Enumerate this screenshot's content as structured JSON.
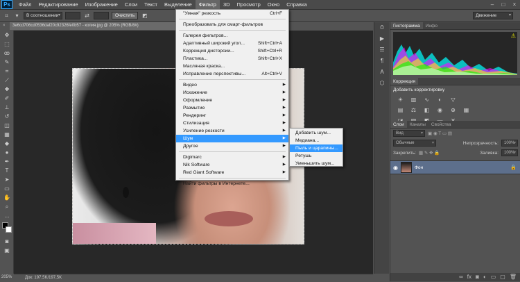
{
  "menubar": {
    "logo": "Ps",
    "items": [
      "Файл",
      "Редактирование",
      "Изображение",
      "Слои",
      "Текст",
      "Выделение",
      "Фильтр",
      "3D",
      "Просмотр",
      "Окно",
      "Справка"
    ],
    "active_index": 6,
    "window_buttons": [
      "–",
      "□",
      "×"
    ]
  },
  "options": {
    "mode_value": "В соотношении",
    "clear_button": "Очистить",
    "workspace_value": "Движение"
  },
  "document": {
    "tab_title": "3e6cd706cd0536daf20c92326fe0b57 - копия.jpg @ 205% (RGB/8#)",
    "status": "Док: 197,5K/197,5K",
    "zoom": "205%"
  },
  "filter_menu": {
    "items": [
      {
        "label": "\"Умная\" резкость",
        "shortcut": "Ctrl+F"
      },
      {
        "sep": true
      },
      {
        "label": "Преобразовать для смарт-фильтров"
      },
      {
        "sep": true
      },
      {
        "label": "Галерея фильтров..."
      },
      {
        "label": "Адаптивный широкий угол...",
        "shortcut": "Shift+Ctrl+A"
      },
      {
        "label": "Коррекция дисторсии...",
        "shortcut": "Shift+Ctrl+R"
      },
      {
        "label": "Пластика...",
        "shortcut": "Shift+Ctrl+X"
      },
      {
        "label": "Масляная краска..."
      },
      {
        "label": "Исправление перспективы...",
        "shortcut": "Alt+Ctrl+V"
      },
      {
        "sep": true
      },
      {
        "label": "Видео",
        "submenu": true
      },
      {
        "label": "Искажение",
        "submenu": true
      },
      {
        "label": "Оформление",
        "submenu": true
      },
      {
        "label": "Размытие",
        "submenu": true
      },
      {
        "label": "Рендеринг",
        "submenu": true
      },
      {
        "label": "Стилизация",
        "submenu": true
      },
      {
        "label": "Усиление резкости",
        "submenu": true
      },
      {
        "label": "Шум",
        "submenu": true,
        "highlight": true
      },
      {
        "label": "Другое",
        "submenu": true
      },
      {
        "sep": true
      },
      {
        "label": "Digimarc",
        "submenu": true
      },
      {
        "label": "Nik Software",
        "submenu": true
      },
      {
        "label": "Red Giant Software",
        "submenu": true
      },
      {
        "sep": true
      },
      {
        "label": "Найти фильтры в Интернете..."
      }
    ]
  },
  "noise_submenu": {
    "items": [
      {
        "label": "Добавить шум..."
      },
      {
        "label": "Медиана..."
      },
      {
        "label": "Пыль и царапины...",
        "highlight": true
      },
      {
        "label": "Ретушь"
      },
      {
        "label": "Уменьшить шум..."
      }
    ]
  },
  "histogram_panel": {
    "tabs": [
      "Гистограмма",
      "Инфо"
    ]
  },
  "corrections_panel": {
    "tab": "Коррекция",
    "title": "Добавить корректировку"
  },
  "layers_panel": {
    "tabs": [
      "Слои",
      "Каналы",
      "Свойства"
    ],
    "kind_value": "Вид",
    "blend_value": "Обычные",
    "opacity_label": "Непрозрачность:",
    "opacity_value": "100%",
    "lock_label": "Закрепить:",
    "fill_label": "Заливка:",
    "fill_value": "100%",
    "layer_name": "Фон"
  },
  "colors": {
    "menu_highlight": "#3399ff",
    "layer_selected": "#5d6f8c"
  }
}
